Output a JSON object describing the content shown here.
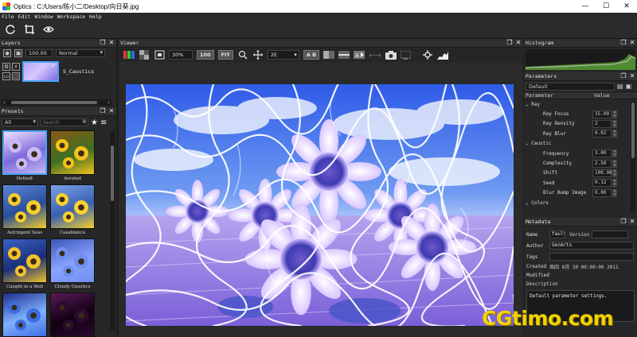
{
  "window": {
    "title": "Optics : C:/Users/陈小二/Desktop/向日葵.jpg",
    "minimize": "—",
    "maximize": "☐",
    "close": "✕"
  },
  "menu": [
    "File",
    "Edit",
    "Window",
    "Workspace",
    "Help"
  ],
  "toolbar": {
    "icons": [
      "refresh-icon",
      "crop-icon",
      "eye-icon"
    ]
  },
  "layers": {
    "title": "Layers",
    "opacity": "100.00",
    "blend_mode": "Normal",
    "layer_name": "S_Caustics"
  },
  "presets": {
    "title": "Presets",
    "filter": "All",
    "search_placeholder": "Search",
    "items": [
      {
        "label": "Default",
        "selected": true,
        "palette": [
          "#c8b8f5",
          "#eee0ff",
          "#7c6ad9"
        ]
      },
      {
        "label": "Aerated",
        "selected": false,
        "palette": [
          "#f2c21b",
          "#8a5a12",
          "#3d6f25"
        ]
      },
      {
        "label": "Astringent Seas",
        "selected": false,
        "palette": [
          "#f4cd2a",
          "#5a86d8",
          "#2a4e9a"
        ]
      },
      {
        "label": "Casablanca",
        "selected": false,
        "palette": [
          "#f6d22e",
          "#7aa2e8",
          "#3a5fb0"
        ]
      },
      {
        "label": "Caught in a Web",
        "selected": false,
        "palette": [
          "#f0c22a",
          "#3b61c8",
          "#1a2f7a"
        ]
      },
      {
        "label": "Cloudy Caustics",
        "selected": false,
        "palette": [
          "#6f8ff0",
          "#3a56b8",
          "#8aa3ff"
        ]
      },
      {
        "label": "",
        "selected": false,
        "palette": [
          "#3d6ee0",
          "#1d2f8a",
          "#7fb0ff"
        ]
      },
      {
        "label": "",
        "selected": false,
        "palette": [
          "#2a0b2e",
          "#5b1a5a",
          "#120012"
        ]
      }
    ]
  },
  "viewer": {
    "title": "Viewer",
    "zoom": "30%",
    "zoom_100": "100",
    "fit": "FIT",
    "view_mode": "2E",
    "ab": "A B"
  },
  "histogram": {
    "title": "Histogram"
  },
  "parameters": {
    "title": "Parameters",
    "preset": "Default",
    "col_param": "Parameter",
    "col_value": "Value",
    "groups": [
      {
        "name": "Ray",
        "items": [
          {
            "name": "Ray Focus",
            "value": "15.00"
          },
          {
            "name": "Ray Density",
            "value": "2"
          },
          {
            "name": "Ray Blur",
            "value": "0.02"
          }
        ]
      },
      {
        "name": "Caustic",
        "items": [
          {
            "name": "Frequency",
            "value": "3.00"
          },
          {
            "name": "Complexity",
            "value": "2.50"
          },
          {
            "name": "Shift",
            "value": "100.00"
          },
          {
            "name": "Seed",
            "value": "0.12"
          },
          {
            "name": "Blur Bump Image",
            "value": "0.00"
          }
        ]
      },
      {
        "name": "Colors",
        "items": []
      }
    ]
  },
  "metadata": {
    "title": "Metadata",
    "name_label": "Name",
    "name_value": "fault",
    "version_label": "Version",
    "version_value": "",
    "author_label": "Author",
    "author_value": "GenArts",
    "tags_label": "Tags",
    "tags_value": "",
    "created_label": "Created",
    "created_value": "周四 6月 30 00:00:00 2011",
    "modified_label": "Modified",
    "modified_value": "",
    "description_label": "Description",
    "description_value": "Default parameter settings."
  },
  "watermark": "CGtimo.com"
}
